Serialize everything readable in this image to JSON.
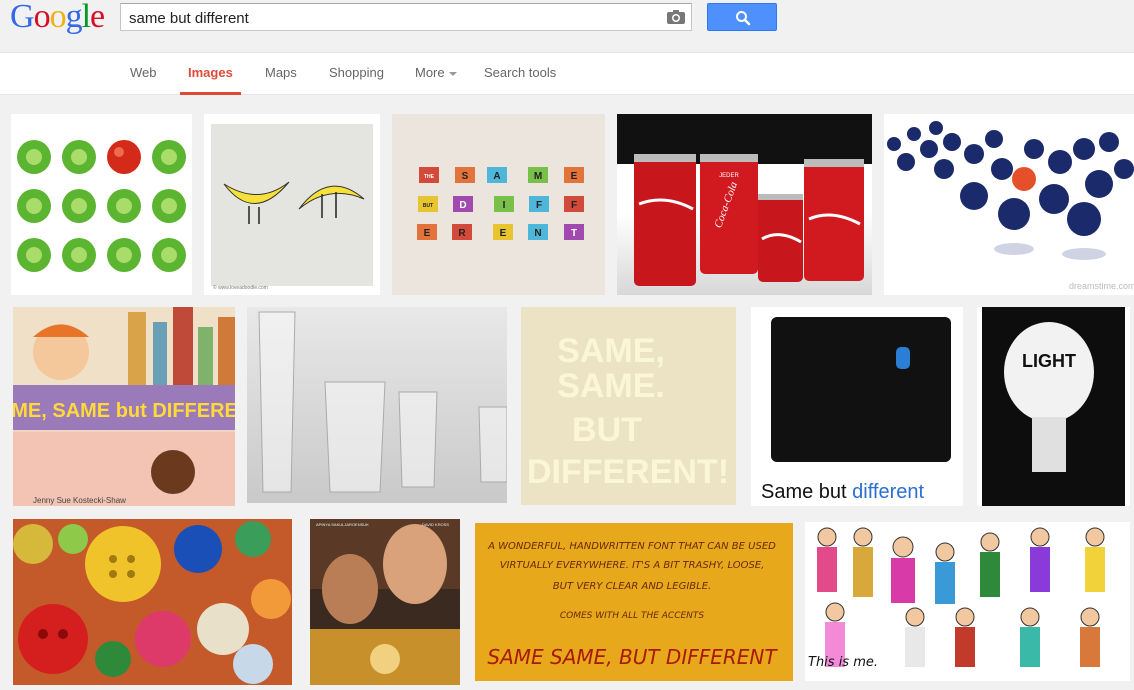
{
  "logo": {
    "letters": [
      "G",
      "o",
      "o",
      "g",
      "l",
      "e"
    ],
    "colors": [
      "#3369e8",
      "#d50f25",
      "#eeb211",
      "#3369e8",
      "#009925",
      "#d50f25"
    ]
  },
  "search": {
    "query": "same but different"
  },
  "nav": {
    "tabs": [
      {
        "label": "Web"
      },
      {
        "label": "Images"
      },
      {
        "label": "Maps"
      },
      {
        "label": "Shopping"
      },
      {
        "label": "More"
      },
      {
        "label": "Search tools"
      }
    ]
  },
  "images": {
    "banana_credit": "© www.loveadoodle.com",
    "letter_tiles": [
      "THE",
      "S",
      "A",
      "M",
      "E",
      "BUT",
      "D",
      "I",
      "F",
      "F",
      "E",
      "R",
      "E",
      "N",
      "T"
    ],
    "can_labels": [
      "JEDER",
      "Coca-Cola"
    ],
    "dreamstime": "dreamstime.com",
    "book_title": "SAME, SAME but DIFFERENT",
    "book_author": "Jenny Sue Kostecki-Shaw",
    "poster_lines": [
      "SAME,",
      "SAME.",
      "BUT",
      "DIFFERENT!"
    ],
    "crowd_caption_1": "Same but ",
    "crowd_caption_2": "different",
    "bulb_text": "LIGHT",
    "movie_credit_left": "APINYA SAKULJAROENSUK",
    "movie_credit_right": "DAVID KROSS",
    "font_sample": [
      "A WONDERFUL, HANDWRITTEN FONT THAT CAN BE USED",
      "VIRTUALLY EVERYWHERE. IT'S A BIT TRASHY, LOOSE,",
      "BUT VERY CLEAR AND LEGIBLE.",
      "COMES WITH ALL THE ACCENTS",
      "SAME SAME, BUT DIFFERENT"
    ],
    "drawing_caption": "This is me."
  }
}
